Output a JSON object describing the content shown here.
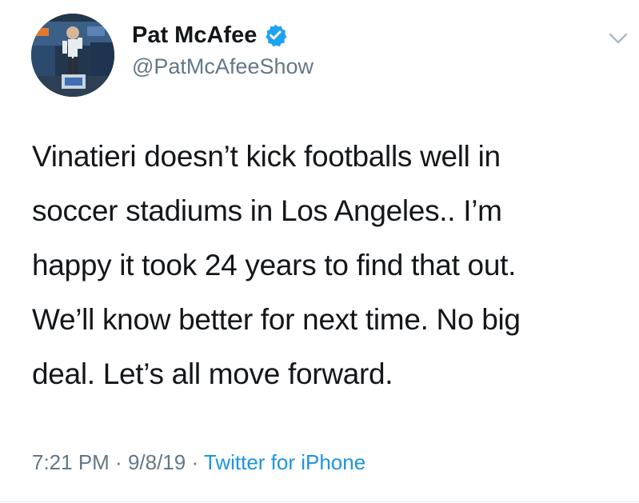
{
  "header": {
    "display_name": "Pat McAfee",
    "handle": "@PatMcAfeeShow",
    "verified": true,
    "avatar_icon": "user-avatar",
    "menu_icon": "chevron-down-icon"
  },
  "tweet": {
    "lines": [
      "Vinatieri doesn’t kick footballs well in",
      "soccer stadiums in Los Angeles.. I’m",
      "happy it took 24 years to find that out.",
      "We’ll know better for next time. No big",
      "deal. Let’s all move forward."
    ]
  },
  "meta": {
    "time": "7:21 PM",
    "sep1": " · ",
    "date": "9/8/19",
    "sep2": " · ",
    "source": "Twitter for iPhone"
  },
  "colors": {
    "text": "#14171a",
    "secondary": "#657786",
    "accent": "#1b95e0",
    "verified": "#1da1f2",
    "divider": "#e1e8ed"
  }
}
